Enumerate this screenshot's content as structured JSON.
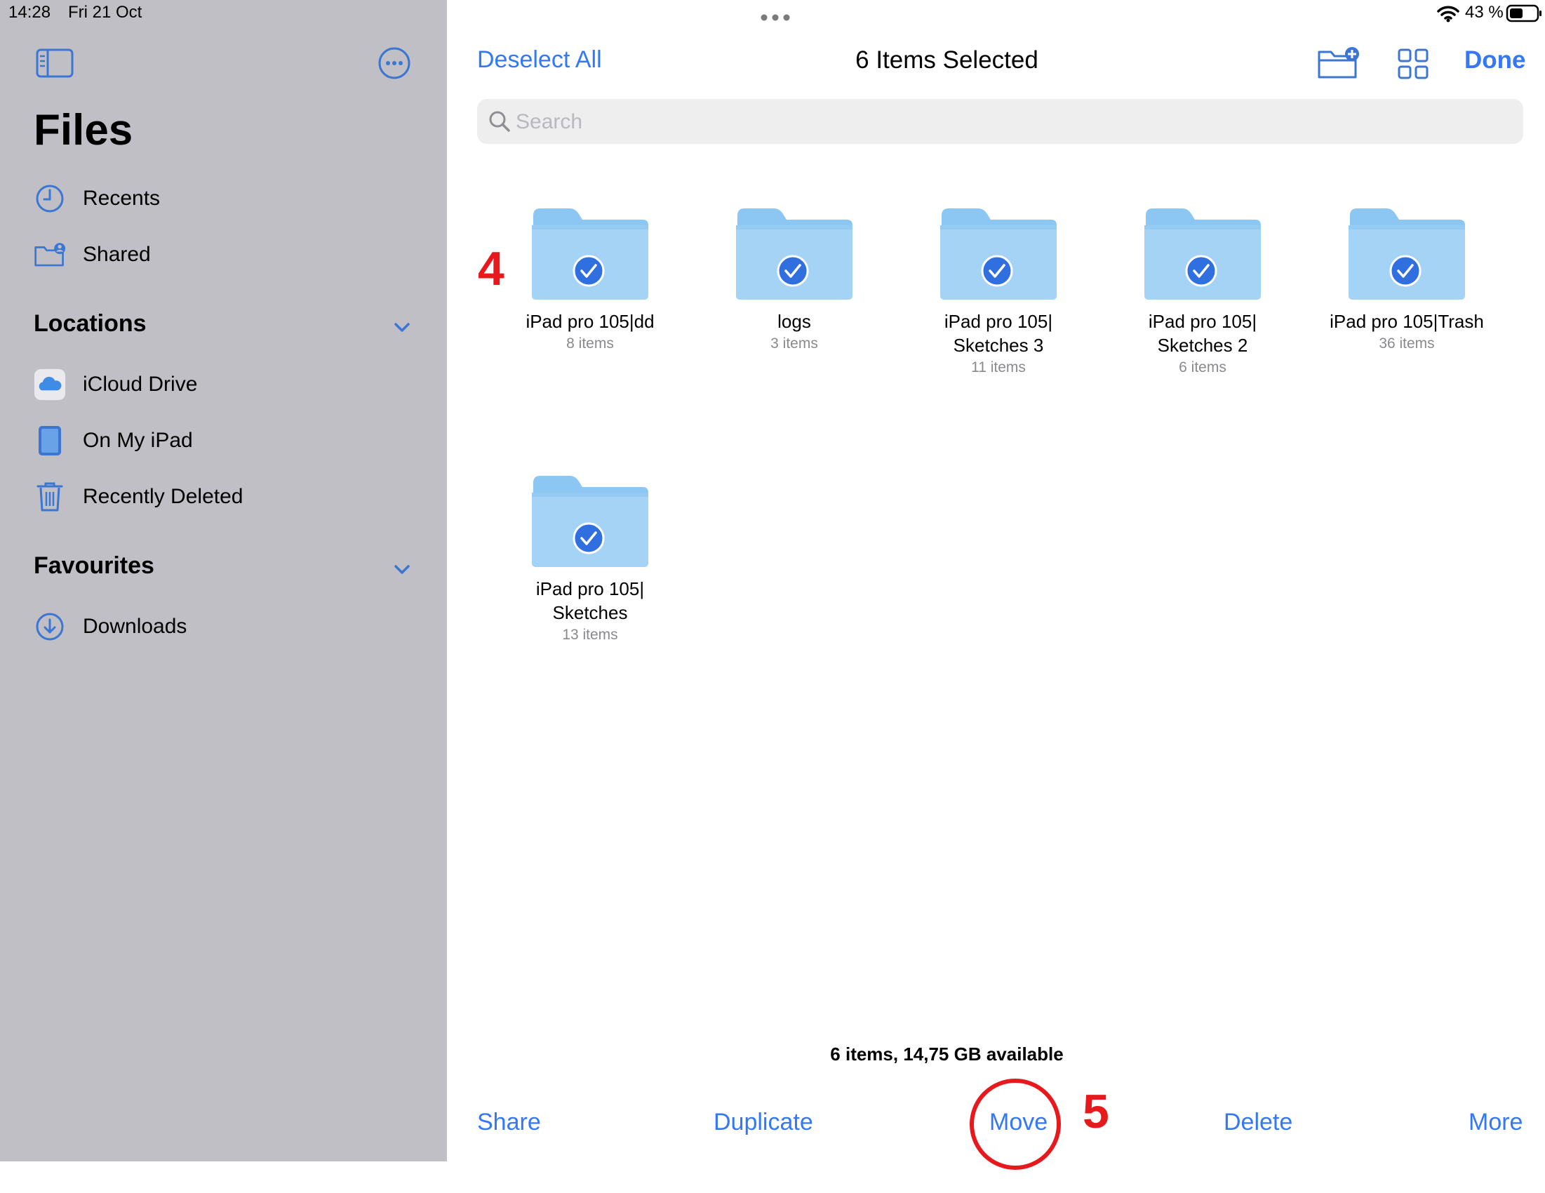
{
  "status_bar": {
    "time": "14:28",
    "date": "Fri 21 Oct",
    "battery": "43 %"
  },
  "sidebar": {
    "title": "Files",
    "top_items": [
      {
        "label": "Recents",
        "icon": "clock-icon"
      },
      {
        "label": "Shared",
        "icon": "shared-folder-icon"
      }
    ],
    "locations_title": "Locations",
    "locations": [
      {
        "label": "iCloud Drive",
        "icon": "icloud-icon"
      },
      {
        "label": "On My iPad",
        "icon": "ipad-icon"
      },
      {
        "label": "Recently Deleted",
        "icon": "trash-icon"
      }
    ],
    "favourites_title": "Favourites",
    "favourites": [
      {
        "label": "Downloads",
        "icon": "download-icon"
      }
    ]
  },
  "header": {
    "deselect_label": "Deselect All",
    "title": "6 Items Selected",
    "done_label": "Done"
  },
  "search": {
    "placeholder": "Search"
  },
  "folders": [
    {
      "name_line1": "iPad pro 105|dd",
      "name_line2": "",
      "count": "8 items"
    },
    {
      "name_line1": "logs",
      "name_line2": "",
      "count": "3 items"
    },
    {
      "name_line1": "iPad pro 105|",
      "name_line2": "Sketches 3",
      "count": "11 items"
    },
    {
      "name_line1": "iPad pro 105|",
      "name_line2": "Sketches 2",
      "count": "6 items"
    },
    {
      "name_line1": "iPad pro 105|Trash",
      "name_line2": "",
      "count": "36 items"
    },
    {
      "name_line1": "iPad pro 105|",
      "name_line2": "Sketches",
      "count": "13 items"
    }
  ],
  "annotations": {
    "step4": "4",
    "step5": "5"
  },
  "footer": {
    "summary": "6 items, 14,75 GB available"
  },
  "toolbar": {
    "share": "Share",
    "duplicate": "Duplicate",
    "move": "Move",
    "delete": "Delete",
    "more": "More"
  },
  "colors": {
    "accent": "#3478f6",
    "sidebar_bg": "#c0bfc5",
    "folder": "#a5d3f6",
    "folder_tab": "#8cc6f2",
    "annotation": "#e8191d"
  }
}
